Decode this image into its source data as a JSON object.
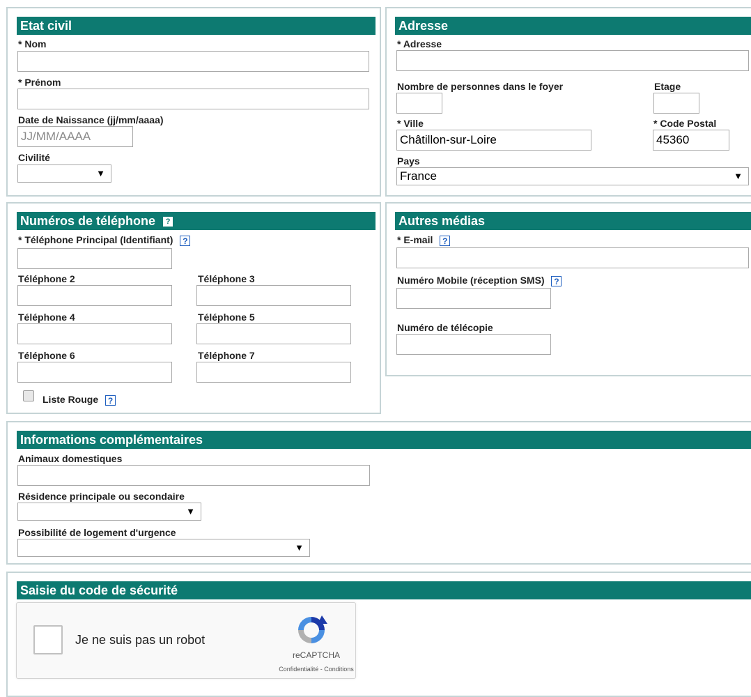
{
  "etat_civil": {
    "title": "Etat civil",
    "nom_label": "* Nom",
    "prenom_label": "* Prénom",
    "naissance_label": "Date de Naissance (jj/mm/aaaa)",
    "naissance_placeholder": "JJ/MM/AAAA",
    "civilite_label": "Civilité",
    "civilite_value": ""
  },
  "adresse": {
    "title": "Adresse",
    "adresse_label": "* Adresse",
    "nb_personnes_label": "Nombre de personnes dans le foyer",
    "etage_label": "Etage",
    "ville_label": "* Ville",
    "ville_value": "Châtillon-sur-Loire",
    "cp_label": "* Code Postal",
    "cp_value": "45360",
    "pays_label": "Pays",
    "pays_value": "France"
  },
  "telephones": {
    "title": "Numéros de téléphone",
    "principal_label": "* Téléphone Principal (Identifiant)",
    "tel2_label": "Téléphone 2",
    "tel3_label": "Téléphone 3",
    "tel4_label": "Téléphone 4",
    "tel5_label": "Téléphone 5",
    "tel6_label": "Téléphone 6",
    "tel7_label": "Téléphone 7",
    "liste_rouge_label": "Liste Rouge"
  },
  "autres_medias": {
    "title": "Autres médias",
    "email_label": "* E-mail",
    "mobile_label": "Numéro Mobile (réception SMS)",
    "fax_label": "Numéro de télécopie"
  },
  "infos": {
    "title": "Informations complémentaires",
    "animaux_label": "Animaux domestiques",
    "residence_label": "Résidence principale ou secondaire",
    "residence_value": "",
    "logement_label": "Possibilité de logement d'urgence",
    "logement_value": ""
  },
  "securite": {
    "title": "Saisie du code de sécurité",
    "captcha_text": "Je ne suis pas un robot",
    "captcha_brand": "reCAPTCHA",
    "captcha_links": "Confidentialité - Conditions"
  },
  "icons": {
    "help_glyph": "?",
    "dropdown_arrow": "▼"
  },
  "colors": {
    "header_bg": "#0d7a71",
    "panel_border": "#c5d4d6",
    "help_blue": "#1f5fbf"
  }
}
